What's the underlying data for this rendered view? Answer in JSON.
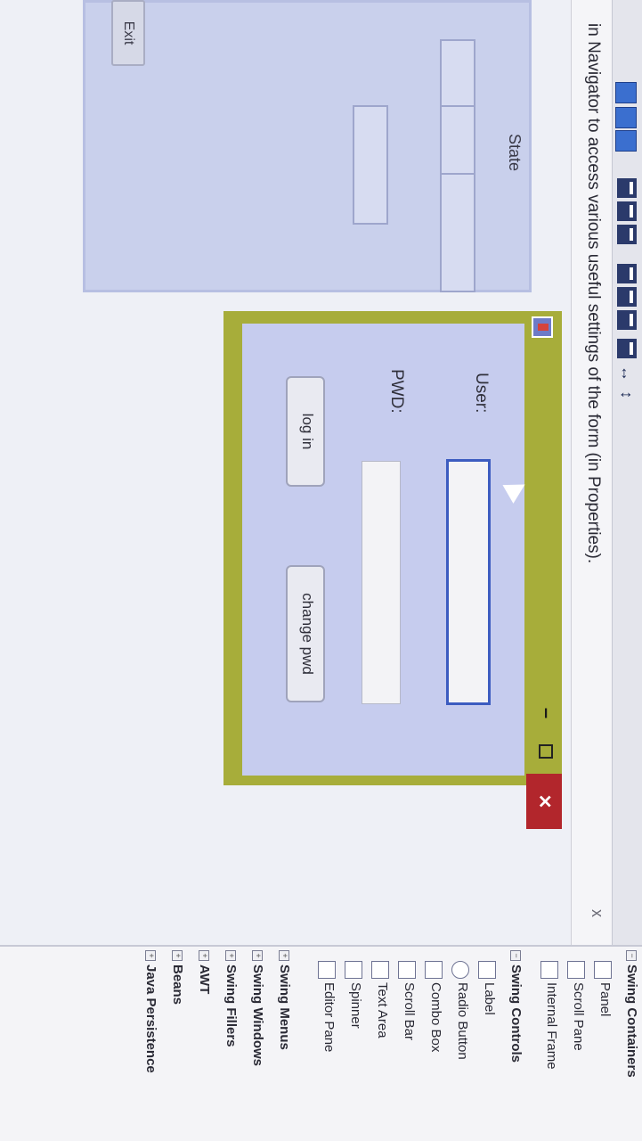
{
  "info_bar": {
    "message": "in Navigator to access various useful settings of the form (in Properties).",
    "close": "x"
  },
  "background_form": {
    "state_label": "State",
    "exit_label": "Exit"
  },
  "dialog": {
    "close_label": "✕",
    "minimize_label": "–",
    "user_label": "User:",
    "pwd_label": "PWD:",
    "user_value": "",
    "pwd_value": "",
    "login_label": "log in",
    "change_label": "change pwd"
  },
  "palette": {
    "containers_header": "Swing Containers",
    "containers": [
      "Panel",
      "Scroll Pane",
      "Internal Frame"
    ],
    "controls_header": "Swing Controls",
    "controls": [
      "Label",
      "Radio Button",
      "Combo Box",
      "Scroll Bar",
      "Text Area",
      "Spinner",
      "Editor Pane"
    ],
    "categories": [
      "Swing Menus",
      "Swing Windows",
      "Swing Fillers",
      "AWT",
      "Beans",
      "Java Persistence"
    ]
  },
  "colors": {
    "dialog_frame": "#a7ad3a",
    "dialog_body": "#c6ccee",
    "close_red": "#b2262c",
    "focus_blue": "#3c5cc0"
  }
}
